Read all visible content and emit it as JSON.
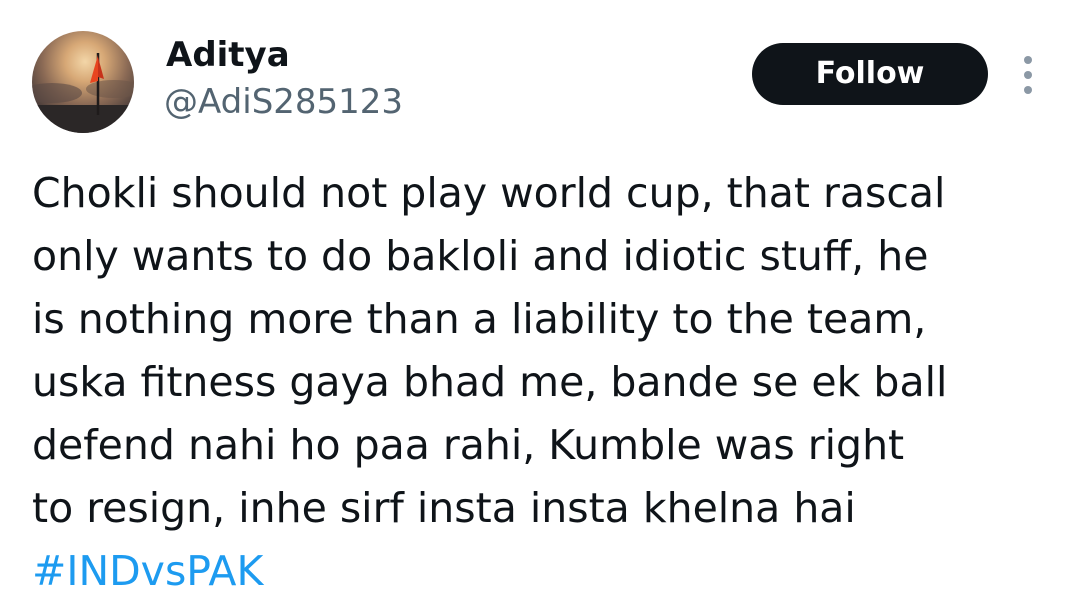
{
  "tweet": {
    "author": {
      "display_name": "Aditya",
      "handle": "@AdiS285123",
      "avatar_icon": "profile-photo-flag-sunset"
    },
    "follow_label": "Follow",
    "more_icon": "more-vertical-icon",
    "text_lines": [
      "Chokli should not play world cup, that rascal",
      "only wants to do bakloli and idiotic stuff, he",
      "is nothing more than a liability to the team,",
      "uska fitness gaya bhad me, bande se ek ball",
      "defend nahi ho paa rahi, Kumble was right",
      "to resign, inhe sirf insta insta khelna hai"
    ],
    "hashtag": "#INDvsPAK"
  },
  "colors": {
    "text": "#0f1419",
    "secondary_text": "#536471",
    "button_bg": "#0f1419",
    "button_text": "#ffffff",
    "link": "#1d9bf0"
  }
}
